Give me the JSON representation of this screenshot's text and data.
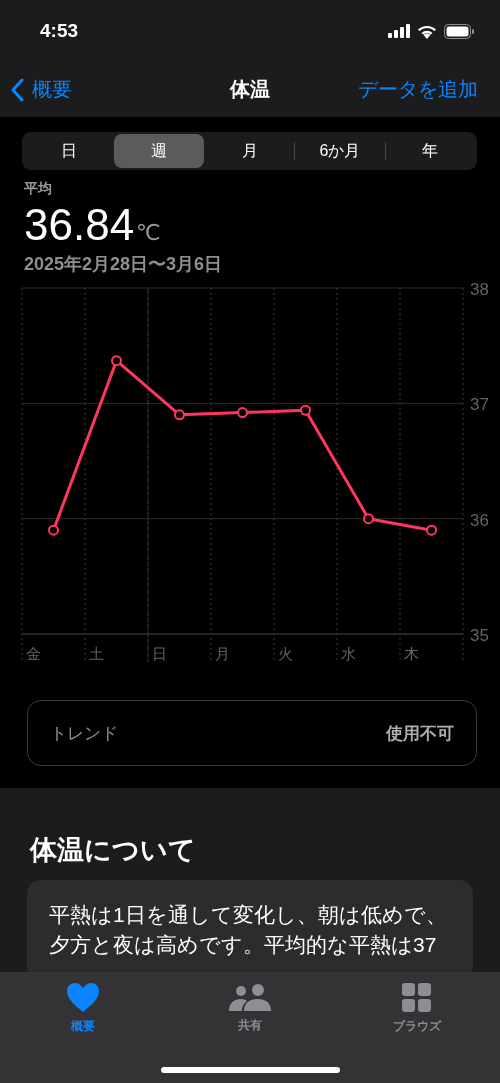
{
  "status_bar": {
    "time": "4:53"
  },
  "nav": {
    "back": "概要",
    "title": "体温",
    "action": "データを追加"
  },
  "ranges": [
    {
      "label": "日",
      "selected": false
    },
    {
      "label": "週",
      "selected": true
    },
    {
      "label": "月",
      "selected": false
    },
    {
      "label": "6か月",
      "selected": false
    },
    {
      "label": "年",
      "selected": false
    }
  ],
  "summary": {
    "label": "平均",
    "value": "36.84",
    "unit": "℃",
    "date_range": "2025年2月28日〜3月6日"
  },
  "chart_data": {
    "type": "line",
    "categories": [
      "金",
      "土",
      "日",
      "月",
      "火",
      "水",
      "木"
    ],
    "ylim": [
      35,
      38
    ],
    "yticks": [
      35,
      36,
      37,
      38
    ],
    "series": [
      {
        "color": "#ff375f",
        "marker": "o",
        "values": [
          35.9,
          37.37,
          36.9,
          36.92,
          36.94,
          36.0,
          35.9
        ]
      }
    ]
  },
  "trend": {
    "label": "トレンド",
    "value": "使用不可"
  },
  "about": {
    "title": "体温について",
    "text": "平熱は1日を通して変化し、朝は低めで、夕方と夜は高めです。平均的な平熱は37"
  },
  "tab_bar": [
    {
      "kind": "heart",
      "label": "概要",
      "selected": true
    },
    {
      "kind": "people",
      "label": "共有",
      "selected": false
    },
    {
      "kind": "grid",
      "label": "ブラウズ",
      "selected": false
    }
  ]
}
